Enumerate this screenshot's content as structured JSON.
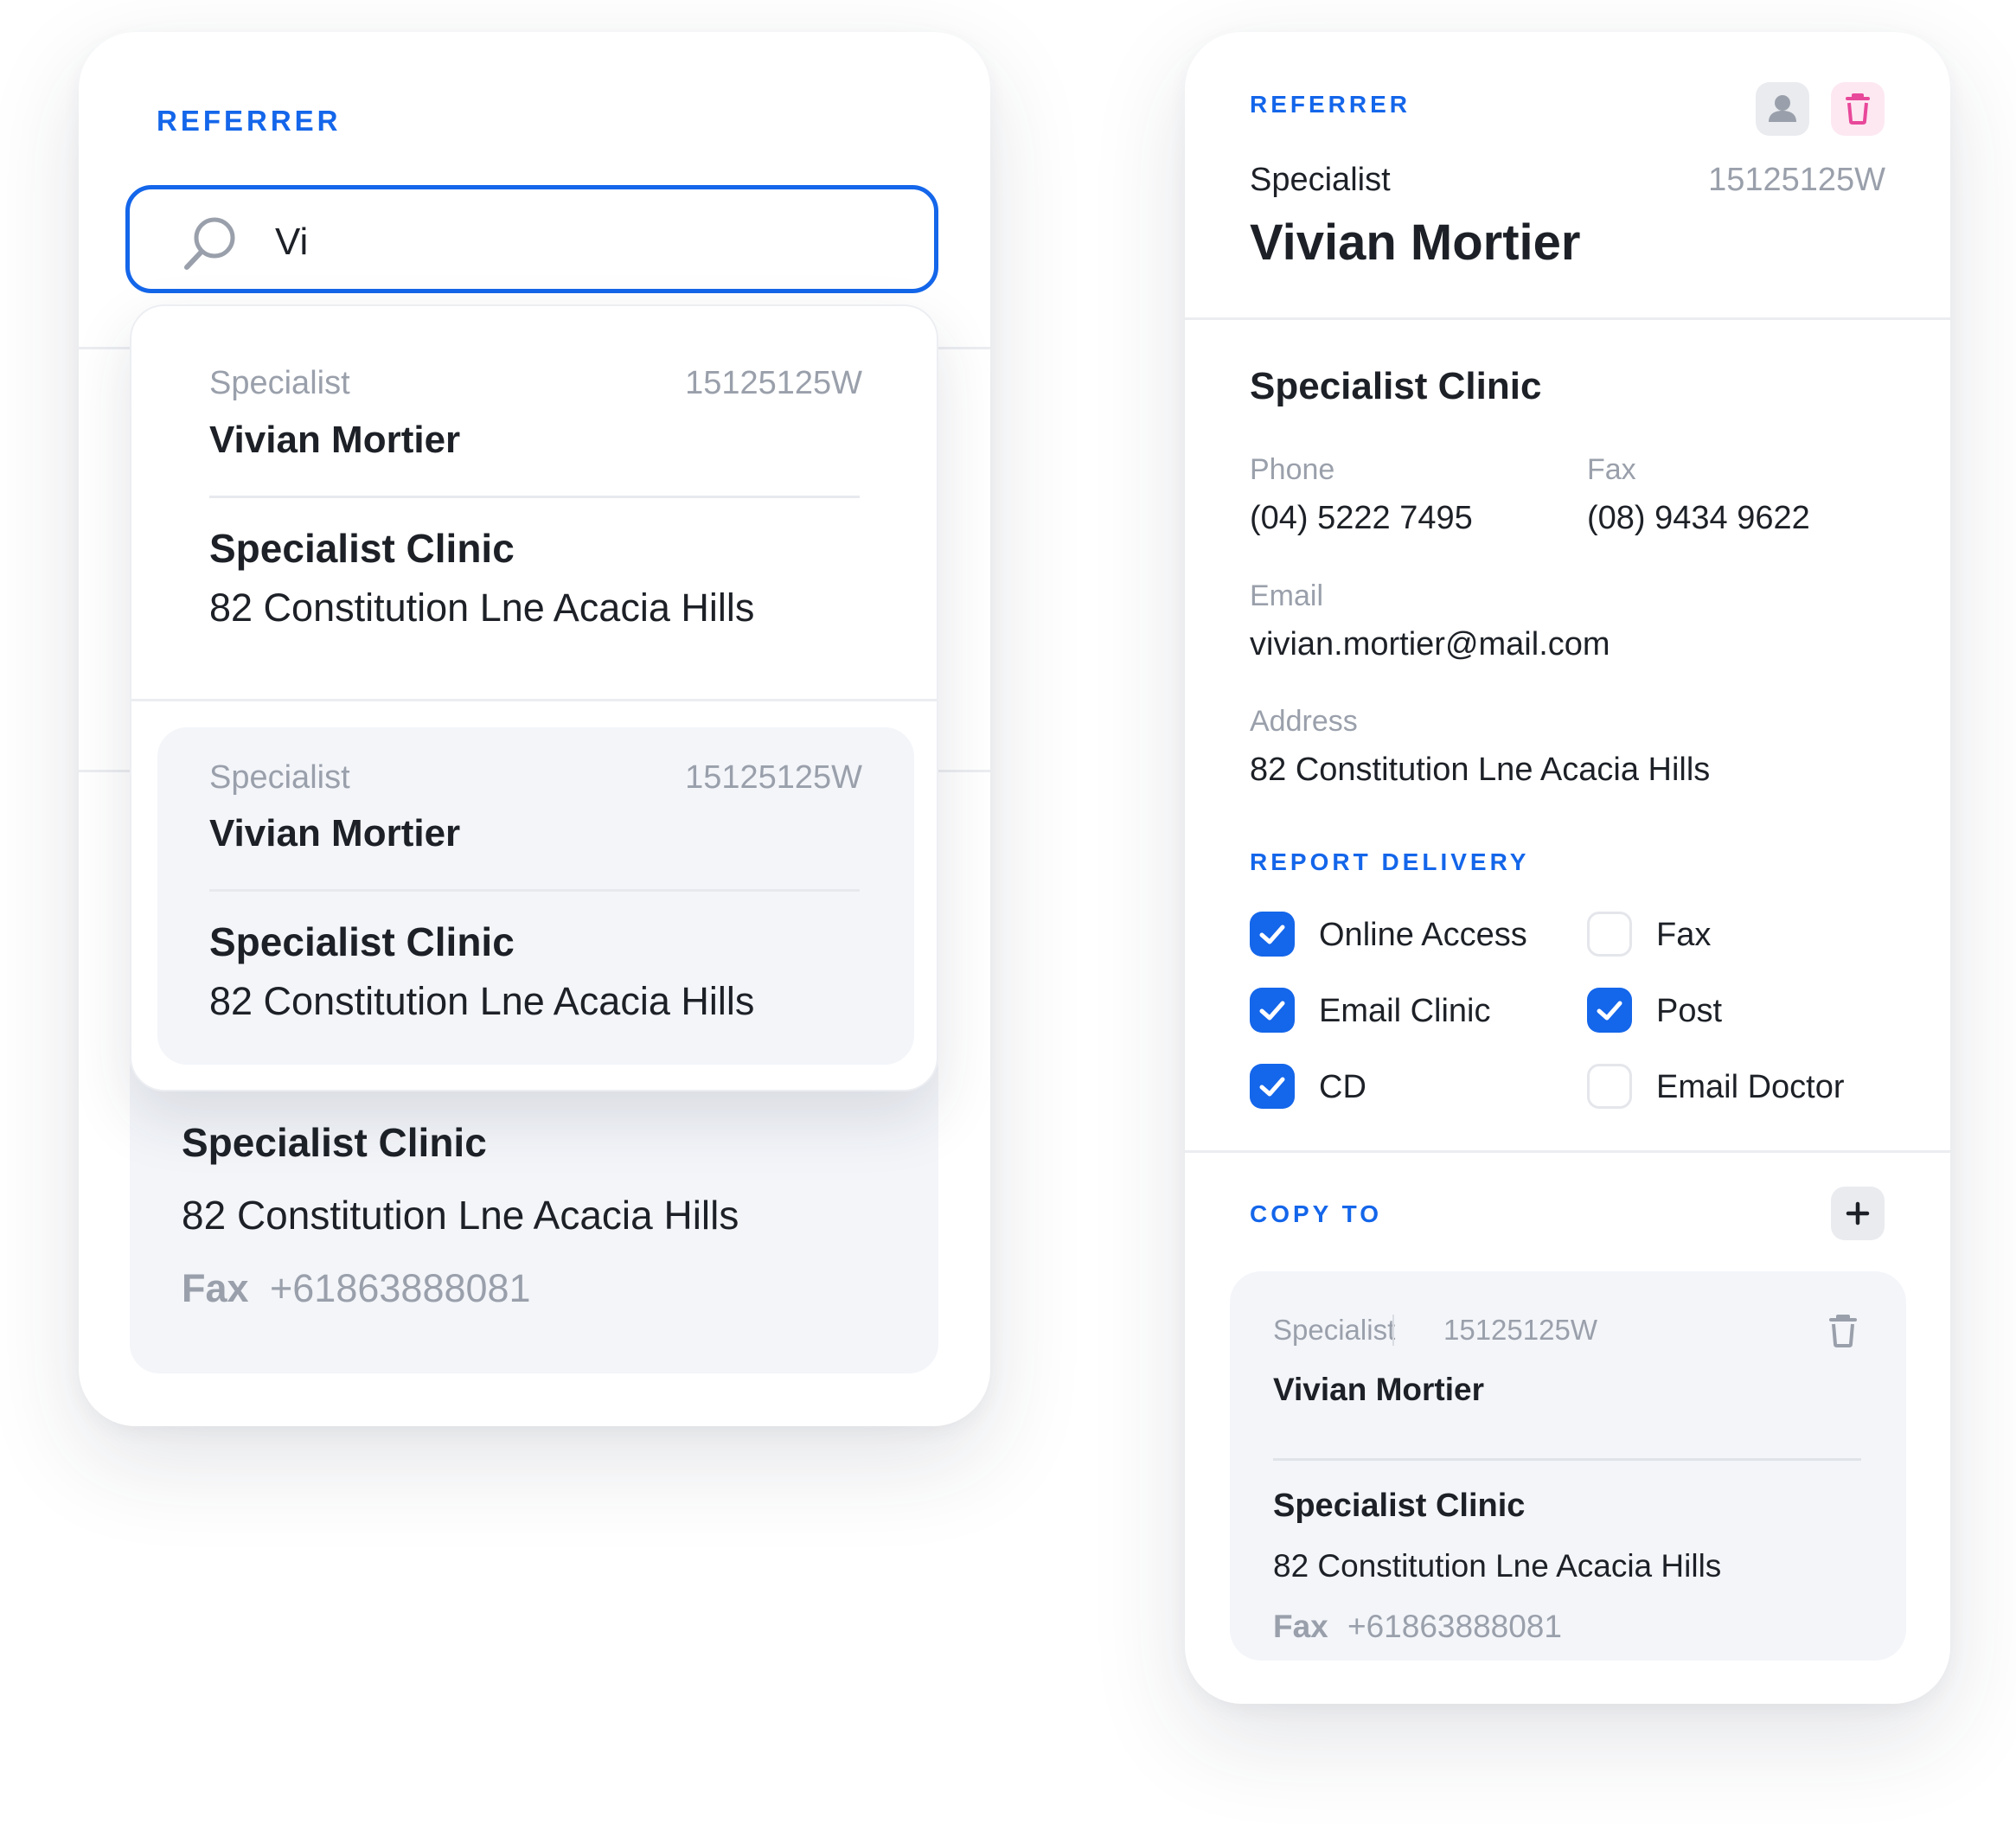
{
  "search_panel": {
    "section_label": "REFERRER",
    "search": {
      "value": "Vi",
      "icon": "search-icon"
    },
    "results": [
      {
        "type": "Specialist",
        "provider_id": "15125125W",
        "name": "Vivian Mortier",
        "clinic": "Specialist Clinic",
        "address": "82 Constitution Lne Acacia Hills"
      },
      {
        "type": "Specialist",
        "provider_id": "15125125W",
        "name": "Vivian Mortier",
        "clinic": "Specialist Clinic",
        "address": "82 Constitution Lne Acacia Hills"
      }
    ],
    "selected_card": {
      "clinic": "Specialist Clinic",
      "address": "82 Constitution Lne Acacia Hills",
      "fax_label": "Fax",
      "fax_value": "+61863888081"
    }
  },
  "detail_panel": {
    "section_label": "REFERRER",
    "header": {
      "type": "Specialist",
      "provider_id": "15125125W",
      "name": "Vivian Mortier"
    },
    "clinic": {
      "name": "Specialist Clinic",
      "phone_label": "Phone",
      "phone": "(04) 5222 7495",
      "fax_label": "Fax",
      "fax": "(08) 9434 9622",
      "email_label": "Email",
      "email": "vivian.mortier@mail.com",
      "address_label": "Address",
      "address": "82 Constitution Lne Acacia Hills"
    },
    "report_delivery": {
      "label": "REPORT DELIVERY",
      "options": [
        {
          "label": "Online Access",
          "checked": true
        },
        {
          "label": "Fax",
          "checked": false
        },
        {
          "label": "Email Clinic",
          "checked": true
        },
        {
          "label": "Post",
          "checked": true
        },
        {
          "label": "CD",
          "checked": true
        },
        {
          "label": "Email Doctor",
          "checked": false
        }
      ]
    },
    "copy_to": {
      "label": "COPY TO",
      "add_icon": "plus-icon",
      "entries": [
        {
          "type": "Specialist",
          "provider_id": "15125125W",
          "name": "Vivian Mortier",
          "clinic": "Specialist Clinic",
          "address": "82 Constitution Lne Acacia Hills",
          "fax_label": "Fax",
          "fax_value": "+61863888081"
        }
      ]
    }
  },
  "colors": {
    "accent": "#1466ea",
    "muted_text": "#9aa0ab",
    "danger": "#e8489a",
    "card_tint": "#f3f5f9"
  }
}
